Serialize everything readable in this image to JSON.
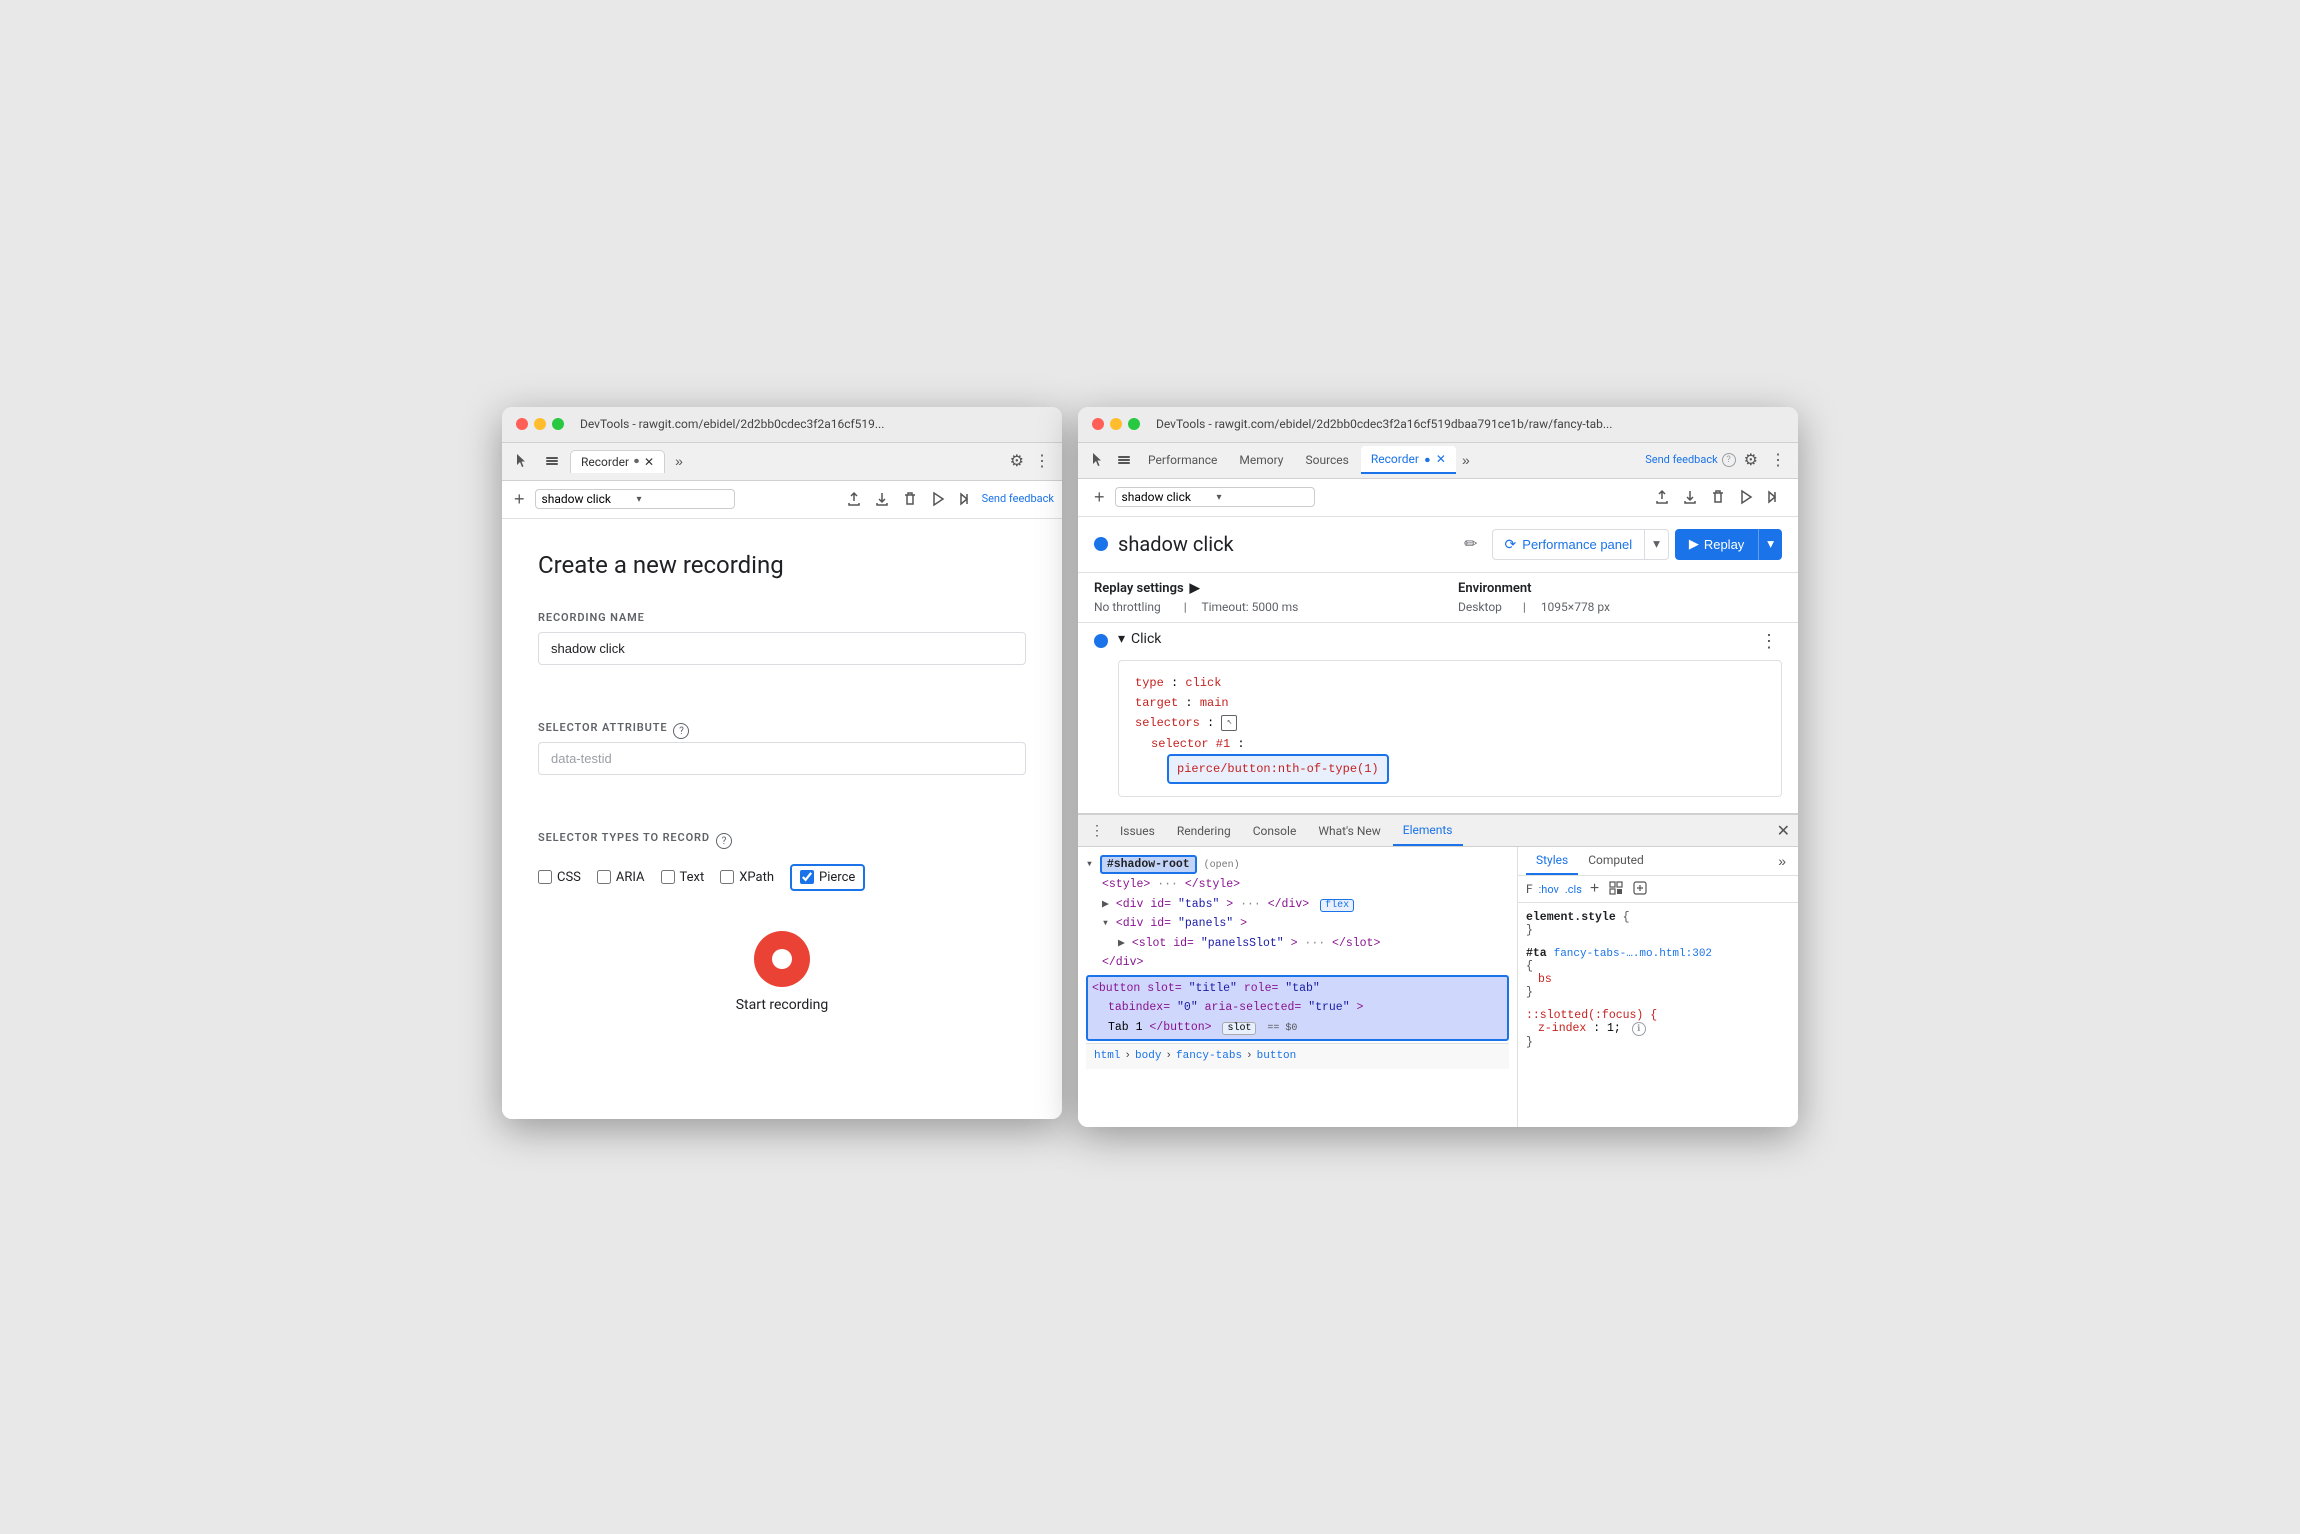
{
  "left_window": {
    "title": "DevTools - rawgit.com/ebidel/2d2bb0cdec3f2a16cf519...",
    "tab_label": "Recorder",
    "recording_name": "shadow click",
    "create_title": "Create a new recording",
    "recording_name_label": "RECORDING NAME",
    "recording_name_value": "shadow click",
    "selector_attr_label": "SELECTOR ATTRIBUTE",
    "selector_attr_placeholder": "data-testid",
    "selector_types_label": "SELECTOR TYPES TO RECORD",
    "checkboxes": [
      {
        "id": "css",
        "label": "CSS",
        "checked": false
      },
      {
        "id": "aria",
        "label": "ARIA",
        "checked": false
      },
      {
        "id": "text",
        "label": "Text",
        "checked": false
      },
      {
        "id": "xpath",
        "label": "XPath",
        "checked": false
      },
      {
        "id": "pierce",
        "label": "Pierce",
        "checked": true
      }
    ],
    "start_label": "Start recording",
    "send_feedback": "Send feedback"
  },
  "right_window": {
    "title": "DevTools - rawgit.com/ebidel/2d2bb0cdec3f2a16cf519dbaa791ce1b/raw/fancy-tab...",
    "tabs": [
      "Performance",
      "Memory",
      "Sources",
      "Recorder",
      "Elements"
    ],
    "active_tab": "Recorder",
    "send_feedback_label": "Send feedback",
    "recording_name": "shadow click",
    "perf_panel_label": "Performance panel",
    "replay_label": "Replay",
    "replay_settings": {
      "title": "Replay settings",
      "throttling": "No throttling",
      "timeout": "Timeout: 5000 ms"
    },
    "environment": {
      "title": "Environment",
      "value": "Desktop",
      "size": "1095×778 px"
    },
    "step": {
      "name": "Click",
      "type": "type: click",
      "target": "target: main",
      "selectors_label": "selectors:",
      "selector_num": "selector #1:",
      "selector_value": "pierce/button:nth-of-type(1)"
    },
    "dom": {
      "shadow_root": "#shadow-root",
      "open_text": "(open)",
      "style_line": "<style>···</style>",
      "tabs_div": "<div id=\"tabs\">···</div>",
      "flex_badge": "flex",
      "panels_div": "<div id=\"panels\">",
      "slot_div": "<slot id=\"panelsSlot\">···</slot>",
      "end_div": "</div>",
      "button_line": "<button slot=\"title\" role=\"tab\"",
      "tabindex_line": "tabindex=\"0\" aria-selected=\"true\">",
      "tab1_line": "Tab 1</button>",
      "slot_badge": "slot",
      "dollar_label": "== $0"
    },
    "breadcrumb": [
      "html",
      "body",
      "fancy-tabs",
      "button"
    ],
    "styles": {
      "tabs": [
        "Styles",
        "Computed"
      ],
      "filter_placeholder": "F",
      "hov": ":hov",
      "cls": ".cls",
      "element_style": "element.style {",
      "close_brace": "}",
      "selector": "#ta",
      "link": "fancy-tabs-….mo.html:302",
      "property": "bs",
      "pseudo": "::slotted(:focus) {",
      "zprop": "z-index: 1;",
      "close2": "}"
    }
  }
}
